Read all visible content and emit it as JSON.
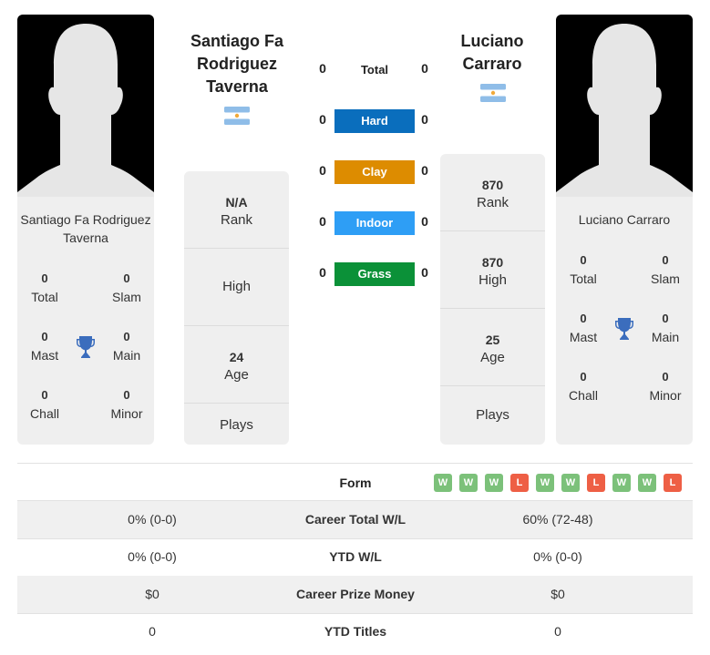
{
  "player1": {
    "name_header": "Santiago Fa Rodriguez Taverna",
    "name_header_lines": [
      "Santiago Fa",
      "Rodriguez",
      "Taverna"
    ],
    "name_card_lines": [
      "Santiago Fa Rodriguez",
      "Taverna"
    ],
    "country": "Argentina",
    "flag_icon": "argentina-flag-icon",
    "titles": {
      "total": {
        "value": "0",
        "label": "Total"
      },
      "slam": {
        "value": "0",
        "label": "Slam"
      },
      "mast": {
        "value": "0",
        "label": "Mast"
      },
      "main": {
        "value": "0",
        "label": "Main"
      },
      "chall": {
        "value": "0",
        "label": "Chall"
      },
      "minor": {
        "value": "0",
        "label": "Minor"
      }
    },
    "info": {
      "rank": {
        "value": "N/A",
        "label": "Rank"
      },
      "high": {
        "value": "",
        "label": "High"
      },
      "age": {
        "value": "24",
        "label": "Age"
      },
      "plays": {
        "value": "",
        "label": "Plays"
      }
    }
  },
  "player2": {
    "name_header": "Luciano Carraro",
    "name_header_lines": [
      "Luciano",
      "Carraro"
    ],
    "name_card_lines": [
      "Luciano Carraro"
    ],
    "country": "Argentina",
    "flag_icon": "argentina-flag-icon",
    "titles": {
      "total": {
        "value": "0",
        "label": "Total"
      },
      "slam": {
        "value": "0",
        "label": "Slam"
      },
      "mast": {
        "value": "0",
        "label": "Mast"
      },
      "main": {
        "value": "0",
        "label": "Main"
      },
      "chall": {
        "value": "0",
        "label": "Chall"
      },
      "minor": {
        "value": "0",
        "label": "Minor"
      }
    },
    "info": {
      "rank": {
        "value": "870",
        "label": "Rank"
      },
      "high": {
        "value": "870",
        "label": "High"
      },
      "age": {
        "value": "25",
        "label": "Age"
      },
      "plays": {
        "value": "",
        "label": "Plays"
      }
    }
  },
  "h2h": {
    "total": {
      "label": "Total",
      "p1": "0",
      "p2": "0"
    },
    "surfaces": [
      {
        "label": "Hard",
        "p1": "0",
        "p2": "0",
        "color": "#0a6ebd"
      },
      {
        "label": "Clay",
        "p1": "0",
        "p2": "0",
        "color": "#dd8c00"
      },
      {
        "label": "Indoor",
        "p1": "0",
        "p2": "0",
        "color": "#2e9ef5"
      },
      {
        "label": "Grass",
        "p1": "0",
        "p2": "0",
        "color": "#0b9138"
      }
    ]
  },
  "form": {
    "label": "Form",
    "results": [
      "W",
      "W",
      "W",
      "L",
      "W",
      "W",
      "L",
      "W",
      "W",
      "L"
    ],
    "colors": {
      "W": "#7cc17a",
      "L": "#ee5f45"
    }
  },
  "table": [
    {
      "label": "Career Total W/L",
      "p1": "0% (0-0)",
      "p2": "60% (72-48)"
    },
    {
      "label": "YTD W/L",
      "p1": "0% (0-0)",
      "p2": "0% (0-0)"
    },
    {
      "label": "Career Prize Money",
      "p1": "$0",
      "p2": "$0"
    },
    {
      "label": "YTD Titles",
      "p1": "0",
      "p2": "0"
    }
  ]
}
